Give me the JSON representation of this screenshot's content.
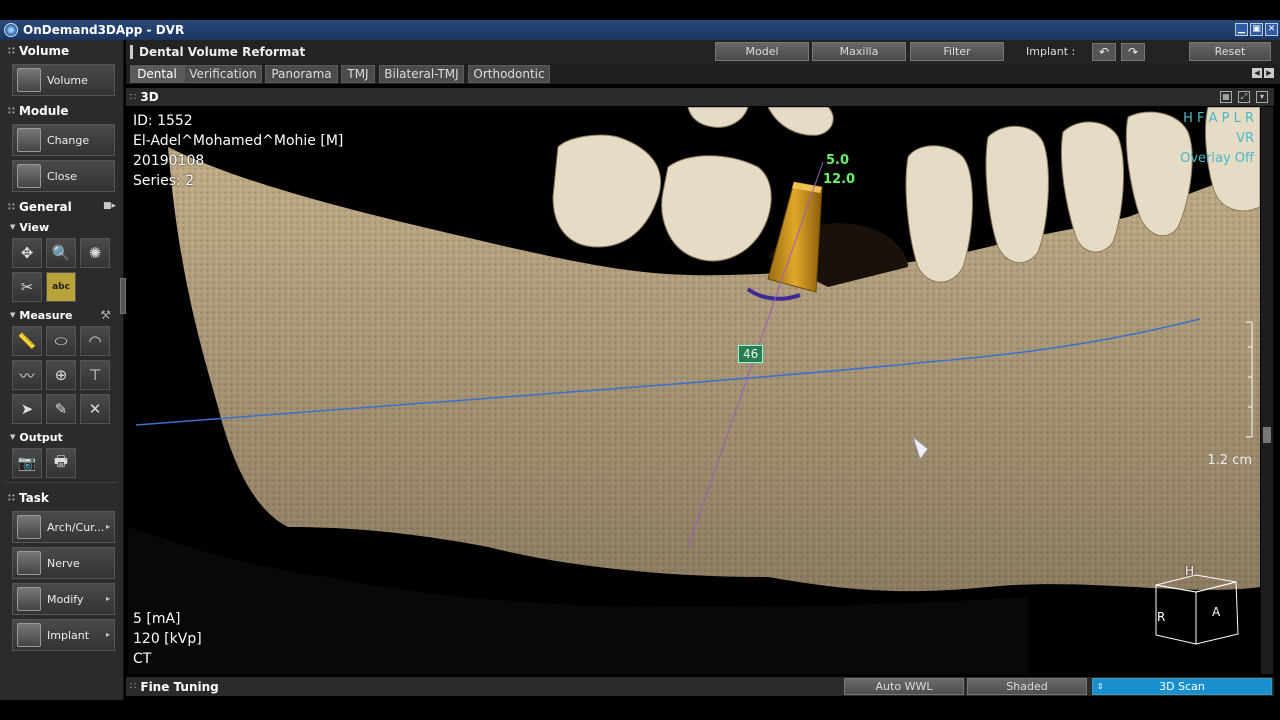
{
  "window": {
    "title": "OnDemand3DApp - DVR"
  },
  "sidebar": {
    "volume": {
      "heading": "Volume",
      "button": "Volume"
    },
    "module": {
      "heading": "Module",
      "change": "Change",
      "close": "Close"
    },
    "general": {
      "heading": "General",
      "view_heading": "View",
      "abc": "abc"
    },
    "measure": {
      "heading": "Measure"
    },
    "output": {
      "heading": "Output"
    },
    "task": {
      "heading": "Task",
      "items": [
        {
          "label": "Arch/Cur..."
        },
        {
          "label": "Nerve"
        },
        {
          "label": "Modify"
        },
        {
          "label": "Implant"
        }
      ]
    }
  },
  "header": {
    "title": "Dental Volume Reformat",
    "model": "Model",
    "maxilla": "Maxilla",
    "filter": "Filter",
    "implant_label": "Implant :",
    "reset": "Reset"
  },
  "tabs": [
    {
      "label": "Dental"
    },
    {
      "label": "Verification"
    },
    {
      "label": "Panorama"
    },
    {
      "label": "TMJ"
    },
    {
      "label": "Bilateral-TMJ"
    },
    {
      "label": "Orthodontic"
    }
  ],
  "view": {
    "title": "3D",
    "patient": {
      "id": "ID: 1552",
      "name": "El-Adel^Mohamed^Mohie [M]",
      "date": "20190108",
      "series": "Series: 2"
    },
    "orientation": "H F A P L R",
    "render_mode": "VR",
    "overlay": "Overlay Off",
    "implant_diameter": "5.0",
    "implant_length": "12.0",
    "tooth_number": "46",
    "scale": "1.2 cm",
    "scan": {
      "ma": "5 [mA]",
      "kvp": "120 [kVp]",
      "modality": "CT"
    },
    "cube": {
      "h": "H",
      "r": "R",
      "a": "A"
    }
  },
  "bottom": {
    "title": "Fine Tuning",
    "auto_wwl": "Auto WWL",
    "shaded": "Shaded",
    "scan_3d": "3D Scan"
  },
  "colors": {
    "accent": "#1a8fd0",
    "bone": "#c9b48e",
    "implant": "#d4a020",
    "guide_line": "#3b6fd4"
  }
}
